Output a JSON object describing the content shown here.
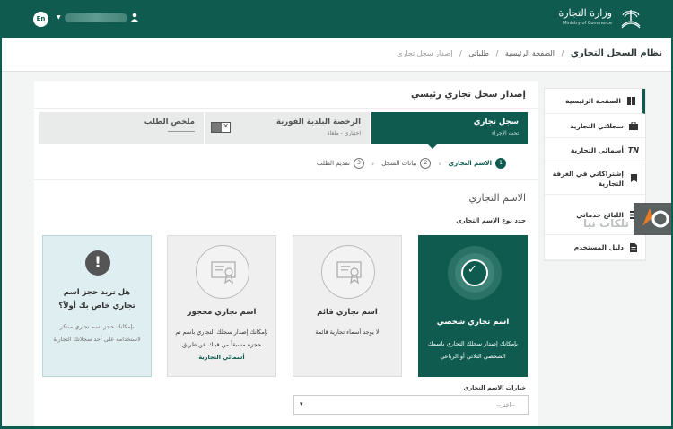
{
  "topbar": {
    "lang": "En",
    "ministry_ar": "وزارة التجارة",
    "ministry_en": "Ministry of Commerce"
  },
  "breadcrumb": {
    "system": "نظام السجل التجاري",
    "home": "الصفحة الرئيسية",
    "requests": "طلباتي",
    "current": "إصدار سجل تجاري"
  },
  "sidebar": {
    "items": [
      {
        "label": "الصفحة الرئيسية",
        "icon": "grid-icon"
      },
      {
        "label": "سجلاتي التجارية",
        "icon": "briefcase-icon"
      },
      {
        "label": "أسمائي التجارية",
        "icon": "tn-icon"
      },
      {
        "label": "إشتراكاتي في الغرفة التجارية",
        "icon": "bookmark-icon"
      },
      {
        "label": "اللبائح خدماتي",
        "icon": "list-icon"
      },
      {
        "label": "دليل المستخدم",
        "icon": "document-icon"
      }
    ]
  },
  "overlay": {
    "text": "تلكات نيا"
  },
  "main": {
    "title": "إصدار سجل تجاري رئيسي",
    "stages": [
      {
        "title": "سجل تجاري",
        "sub": "تحت الإجراء"
      },
      {
        "title": "الرخصة البلدية الفورية",
        "sub": "اختياري - ملغاة"
      },
      {
        "title": "ملخص الطلب",
        "sub": ""
      }
    ],
    "steps": [
      {
        "num": "1",
        "label": "الاسم التجاري"
      },
      {
        "num": "2",
        "label": "بيانات السجل"
      },
      {
        "num": "3",
        "label": "تقديم الطلب"
      }
    ],
    "section_title": "الاسم التجاري",
    "section_sub": "حدد نوع الإسم التجاري",
    "cards": [
      {
        "title": "اسم تجاري شخصي",
        "desc": "بإمكانك إصدار سجلك التجاري باسمك الشخصي الثلاثي أو الرباعي"
      },
      {
        "title": "اسم تجاري قائم",
        "desc": "لا يوجد أسماء تجارية قائمة"
      },
      {
        "title": "اسم تجاري محجوز",
        "desc": "بإمكانك إصدار سجلك التجاري باسم تم حجزه مسبقاً من قبلك عن طريق",
        "link": "أسمائي التجارية"
      },
      {
        "title": "هل تريد حجز اسم تجاري خاص بك أولاً؟",
        "desc": "بإمكانك حجز اسم تجاري مبتكر لاستخدامه على أحد سجلاتك التجارية"
      }
    ],
    "select": {
      "label": "خيارات الاسم التجاري",
      "placeholder": "--اختر--"
    }
  },
  "colors": {
    "brand": "#0f5b50",
    "card_light": "#dfeef0"
  }
}
